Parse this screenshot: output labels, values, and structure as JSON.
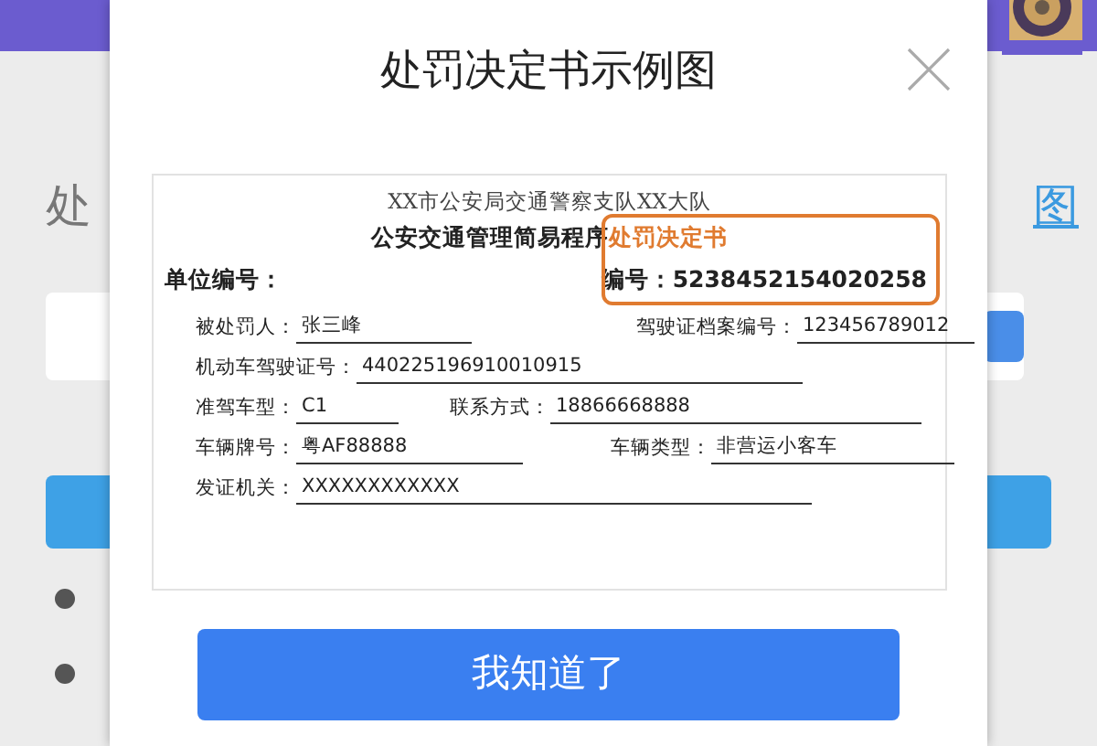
{
  "background": {
    "heading_char": "处",
    "link_char": "图"
  },
  "dialog": {
    "title": "处罚决定书示例图",
    "document": {
      "issuer": "XX市公安局交通警察支队XX大队",
      "title": "公安交通管理简易程序",
      "title_highlight": "处罚决定书",
      "unit_label": "单位编号：",
      "number_label": "编号：",
      "number": "5238452154020258",
      "rows": [
        [
          {
            "label": "被处罚人：",
            "value": "张三峰"
          },
          {
            "label": "驾驶证档案编号：",
            "value": "123456789012"
          }
        ],
        [
          {
            "label": "机动车驾驶证号：",
            "value": "440225196910010915"
          }
        ],
        [
          {
            "label": "准驾车型：",
            "value": "C1"
          },
          {
            "label": "联系方式：",
            "value": "18866668888"
          }
        ],
        [
          {
            "label": "车辆牌号：",
            "value": "粤AF88888"
          },
          {
            "label": "车辆类型：",
            "value": "非营运小客车"
          }
        ],
        [
          {
            "label": "发证机关：",
            "value": "XXXXXXXXXXXX"
          }
        ]
      ]
    },
    "confirm_button": "我知道了"
  }
}
